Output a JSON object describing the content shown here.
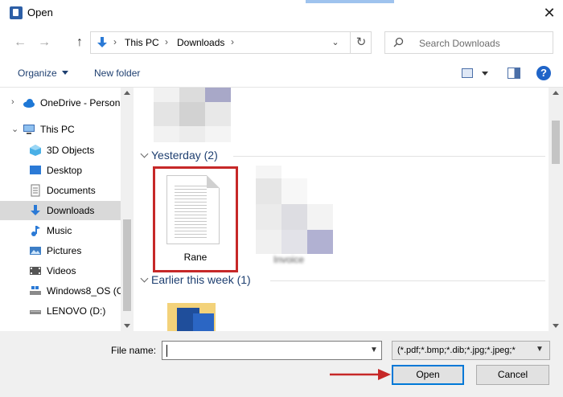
{
  "window": {
    "title": "Open",
    "close_glyph": "✕"
  },
  "nav": {
    "back_glyph": "←",
    "forward_glyph": "→",
    "up_glyph": "↑"
  },
  "address": {
    "crumbs": [
      "This PC",
      "Downloads"
    ],
    "separator": "›",
    "dropdown_glyph": "⌄",
    "refresh_glyph": "↻"
  },
  "search": {
    "placeholder": "Search Downloads"
  },
  "toolbar": {
    "organize": "Organize",
    "new_folder": "New folder",
    "help": "?"
  },
  "sidebar": {
    "items": [
      {
        "label": "OneDrive - Person",
        "icon": "cloud-icon",
        "color": "#1e78d6"
      },
      {
        "label": "This PC",
        "icon": "computer-icon",
        "color": "#3a6cb2"
      },
      {
        "label": "3D Objects",
        "icon": "cube-icon",
        "color": "#4ab0e6"
      },
      {
        "label": "Desktop",
        "icon": "desktop-icon",
        "color": "#2b7ad6"
      },
      {
        "label": "Documents",
        "icon": "documents-icon",
        "color": "#8a8a8a"
      },
      {
        "label": "Downloads",
        "icon": "download-icon",
        "color": "#2b7ad6"
      },
      {
        "label": "Music",
        "icon": "music-icon",
        "color": "#2b7ad6"
      },
      {
        "label": "Pictures",
        "icon": "pictures-icon",
        "color": "#3d7ec6"
      },
      {
        "label": "Videos",
        "icon": "videos-icon",
        "color": "#555555"
      },
      {
        "label": "Windows8_OS (C",
        "icon": "drive-os-icon",
        "color": "#2b7ad6"
      },
      {
        "label": "LENOVO (D:)",
        "icon": "drive-icon",
        "color": "#555555"
      }
    ],
    "selected": "Downloads"
  },
  "groups": [
    {
      "label": "Yesterday (2)"
    },
    {
      "label": "Earlier this week (1)"
    }
  ],
  "files": [
    {
      "name": "Rane",
      "icon": "text-document-icon",
      "highlighted": true
    }
  ],
  "blurred_label": "Invoice",
  "footer": {
    "file_name_label": "File name:",
    "file_name_value": "",
    "file_type": "(*.pdf;*.bmp;*.dib;*.jpg;*.jpeg;*",
    "open": "Open",
    "cancel": "Cancel"
  },
  "colors": {
    "accent": "#0078d7",
    "highlight": "#c62828",
    "link": "#1e3f70"
  }
}
